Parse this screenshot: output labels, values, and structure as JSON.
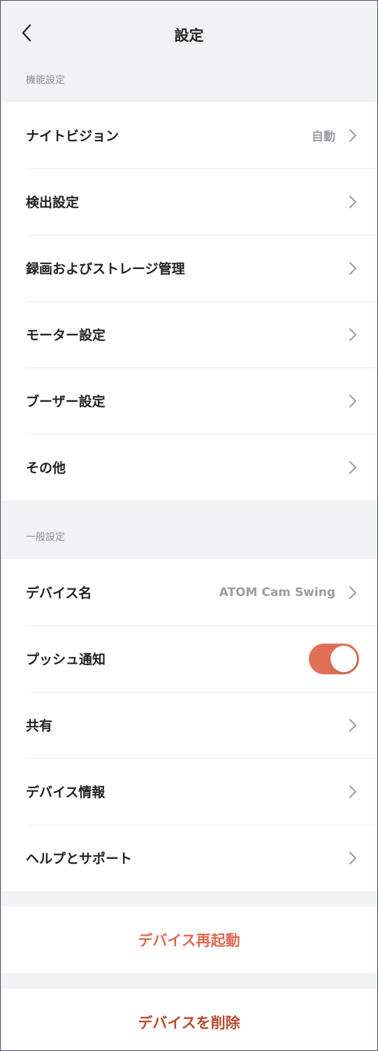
{
  "header": {
    "title": "設定",
    "back_icon": "chevron-left-icon"
  },
  "sections": {
    "feature": {
      "title": "機能設定",
      "items": [
        {
          "label": "ナイトビジョン",
          "value": "自動"
        },
        {
          "label": "検出設定"
        },
        {
          "label": "録画およびストレージ管理"
        },
        {
          "label": "モーター設定"
        },
        {
          "label": "ブーザー設定"
        },
        {
          "label": "その他"
        }
      ]
    },
    "general": {
      "title": "一般設定",
      "items": [
        {
          "label": "デバイス名",
          "value": "ATOM Cam Swing"
        },
        {
          "label": "プッシュ通知",
          "toggle_on": true
        },
        {
          "label": "共有"
        },
        {
          "label": "デバイス情報"
        },
        {
          "label": "ヘルプとサポート"
        }
      ]
    }
  },
  "actions": {
    "restart_label": "デバイス再起動",
    "delete_label": "デバイスを削除"
  },
  "colors": {
    "accent": "#e07055",
    "restart_text": "#de6a4f",
    "delete_text": "#b84a2e",
    "background": "#f2f2f5",
    "secondary_text": "#9a9ca3"
  }
}
